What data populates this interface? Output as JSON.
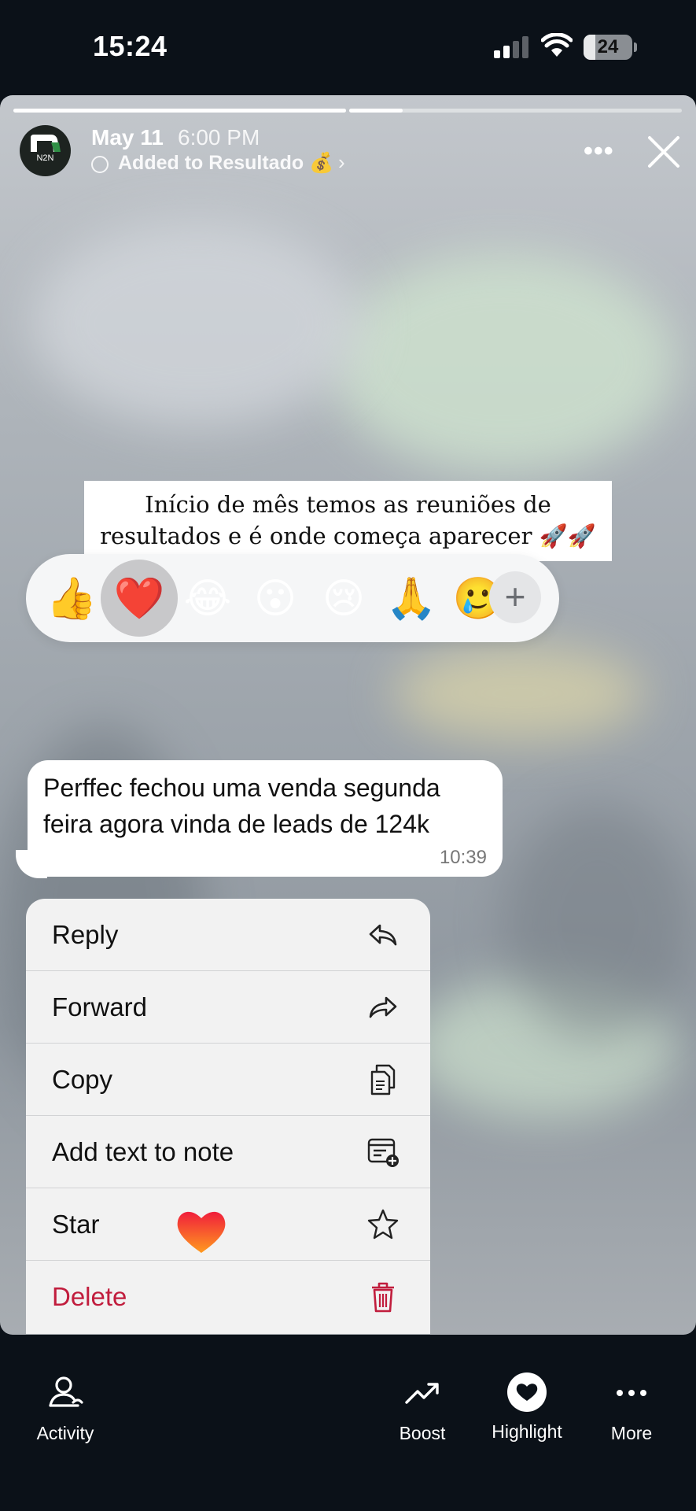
{
  "status_bar": {
    "time": "15:24",
    "battery": "24",
    "battery_level": 0.24
  },
  "story": {
    "progress": [
      1.0,
      0.16
    ],
    "header": {
      "avatar_text": "N2N",
      "date": "May 11",
      "time": "6:00 PM",
      "added_label": "Added to Resultado 💰",
      "more_icon": "more-horizontal-icon",
      "close_icon": "close-icon"
    },
    "caption": "Início de mês temos as reuniões de resultados e é onde começa aparecer 🚀🚀",
    "reactions": {
      "emojis": [
        "👍",
        "❤️",
        "😂",
        "😮",
        "😢",
        "🙏",
        "🥲"
      ],
      "selected_index": 1,
      "add_label": "+"
    },
    "message": {
      "text": "Perffec fechou uma venda segunda feira agora vinda de leads de 124k",
      "time": "10:39"
    },
    "context_menu": {
      "items": [
        {
          "label": "Reply",
          "icon": "reply-icon"
        },
        {
          "label": "Forward",
          "icon": "forward-icon"
        },
        {
          "label": "Copy",
          "icon": "copy-icon"
        },
        {
          "label": "Add text to note",
          "icon": "add-note-icon"
        },
        {
          "label": "Star",
          "icon": "star-icon"
        },
        {
          "label": "Delete",
          "icon": "trash-icon"
        }
      ]
    }
  },
  "bottom_bar": {
    "items": [
      {
        "label": "Activity",
        "icon": "activity-icon"
      },
      {
        "label": "Boost",
        "icon": "trending-up-icon"
      },
      {
        "label": "Highlight",
        "icon": "heart-highlight-icon"
      },
      {
        "label": "More",
        "icon": "more-icon"
      }
    ]
  },
  "colors": {
    "background": "#0b1118",
    "danger": "#c11d3d",
    "menu_bg": "#f2f2f2",
    "reaction_selected": "#c8c8ca"
  }
}
